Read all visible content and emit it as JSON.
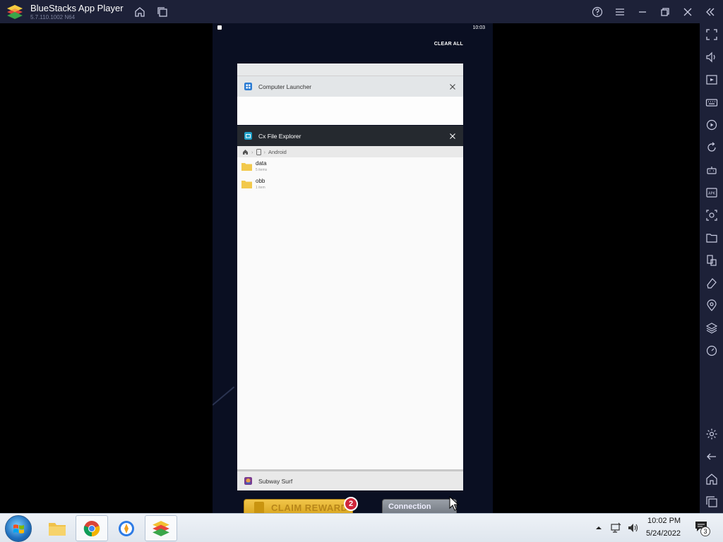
{
  "titlebar": {
    "title": "BlueStacks App Player",
    "version": "5.7.110.1002  N64"
  },
  "android": {
    "status_time": "10:03",
    "clear_all": "CLEAR ALL",
    "recents": [
      {
        "app": "Computer Launcher"
      },
      {
        "app": "Cx File Explorer",
        "breadcrumb": "Android",
        "folders": [
          {
            "name": "data",
            "sub": "5 items"
          },
          {
            "name": "obb",
            "sub": "1 item"
          }
        ]
      },
      {
        "app": "Subway Surf"
      }
    ],
    "game": {
      "claim_label": "CLAIM REWARD",
      "claim_badge": "2",
      "connection_label": "Connection"
    }
  },
  "taskbar": {
    "time": "10:02 PM",
    "date": "5/24/2022",
    "notification_count": "3"
  },
  "colors": {
    "titlebar_bg": "#1d2138",
    "cx_header_bg": "#25292f",
    "folder_yellow": "#f2c94c"
  }
}
